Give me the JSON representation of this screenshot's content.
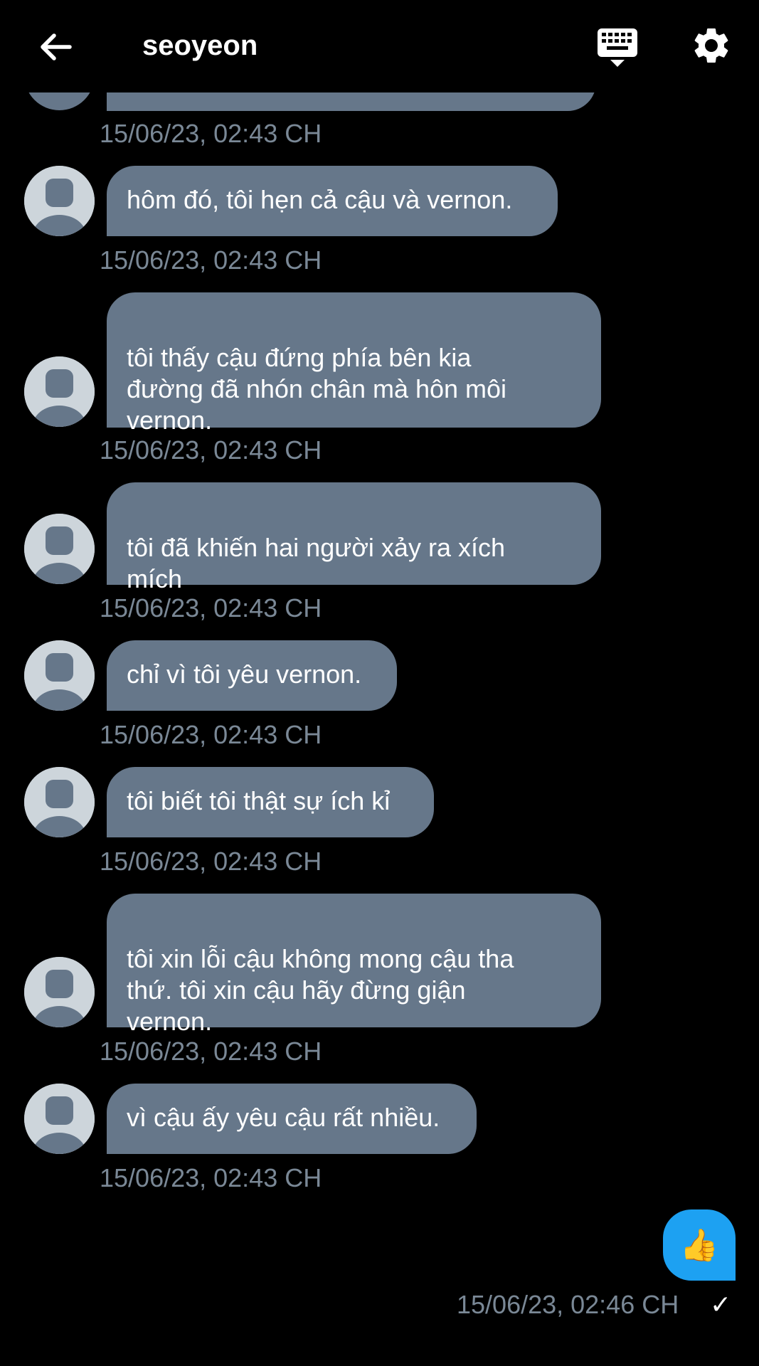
{
  "header": {
    "title": "seoyeon",
    "back_icon": "arrow-left-icon",
    "keyboard_icon": "keyboard-icon",
    "settings_icon": "gear-icon"
  },
  "messages": [
    {
      "text": "",
      "timestamp": "15/06/23, 02:43 CH"
    },
    {
      "text": "hôm đó, tôi hẹn cả cậu và vernon.",
      "timestamp": "15/06/23, 02:43 CH"
    },
    {
      "text": "tôi thấy cậu đứng phía bên kia\nđường đã nhón chân mà hôn môi\nvernon.",
      "timestamp": "15/06/23, 02:43 CH"
    },
    {
      "text": "tôi đã khiến hai người xảy ra xích\nmích",
      "timestamp": "15/06/23, 02:43 CH"
    },
    {
      "text": "chỉ vì tôi yêu vernon.",
      "timestamp": "15/06/23, 02:43 CH"
    },
    {
      "text": "tôi biết tôi thật sự ích kỉ",
      "timestamp": "15/06/23, 02:43 CH"
    },
    {
      "text": "tôi xin lỗi cậu không mong cậu tha\nthứ. tôi xin cậu hãy đừng giận\nvernon.",
      "timestamp": "15/06/23, 02:43 CH"
    },
    {
      "text": "vì cậu ấy yêu cậu rất nhiều.",
      "timestamp": "15/06/23, 02:43 CH"
    }
  ],
  "sent": {
    "emoji": "👍",
    "timestamp": "15/06/23, 02:46 CH",
    "status": "✓"
  },
  "colors": {
    "background": "#000000",
    "received_bubble": "#66778a",
    "sent_bubble": "#1da1f2",
    "timestamp": "#7a8896"
  }
}
